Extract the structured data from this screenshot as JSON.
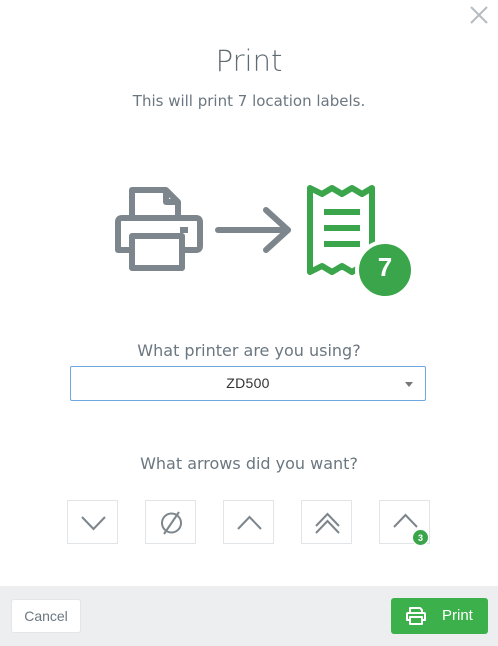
{
  "dialog": {
    "title": "Print",
    "subtitle": "This will print 7 location labels."
  },
  "illustration": {
    "label_count": "7",
    "printer_icon": "printer-icon",
    "arrow_icon": "arrow-right-icon",
    "receipt_icon": "label-receipt-icon",
    "accent_color": "#3aa54a",
    "printer_color": "#7d868c"
  },
  "printer_select": {
    "question": "What printer are you using?",
    "value": "ZD500"
  },
  "arrows": {
    "question": "What arrows did you want?",
    "options": [
      {
        "icon": "arrow-down-icon"
      },
      {
        "icon": "no-arrow-icon"
      },
      {
        "icon": "arrow-up-icon"
      },
      {
        "icon": "double-arrow-up-icon"
      },
      {
        "icon": "arrow-up-icon",
        "badge": "3"
      }
    ]
  },
  "footer": {
    "cancel_label": "Cancel",
    "print_label": "Print",
    "print_color": "#3cb04b"
  }
}
